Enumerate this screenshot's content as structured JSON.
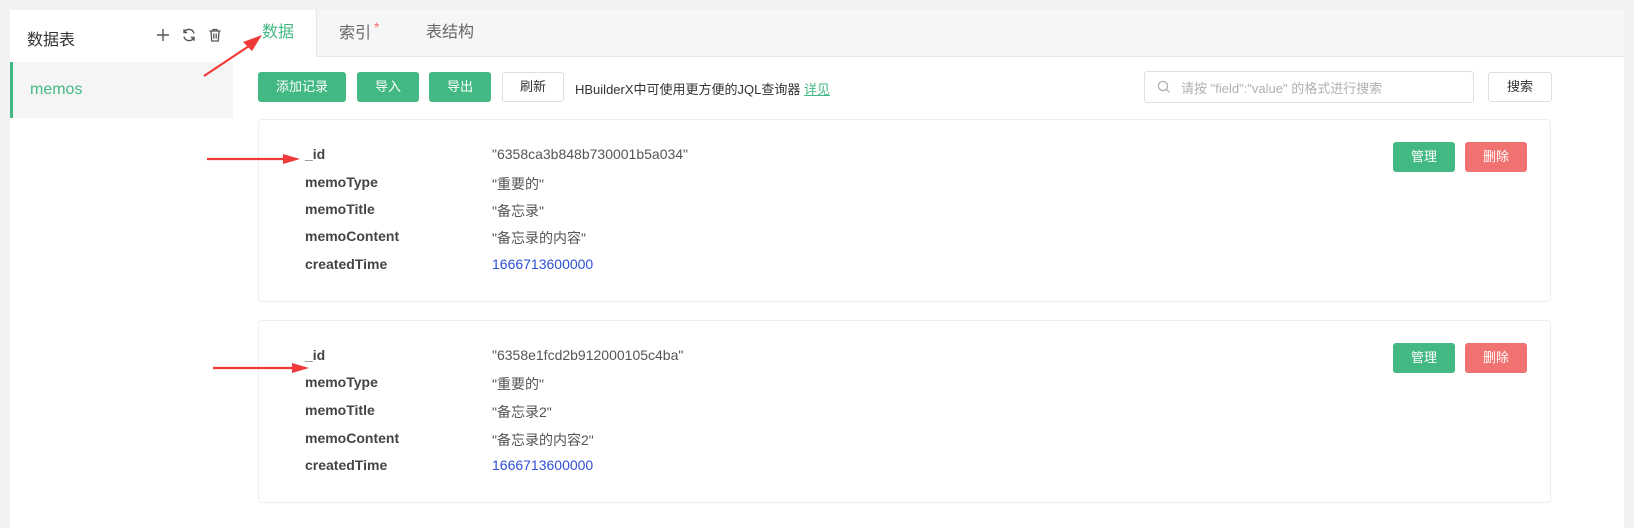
{
  "sidebar": {
    "title": "数据表",
    "icons": [
      "plus-icon",
      "refresh-icon",
      "trash-icon"
    ],
    "tables": [
      {
        "name": "memos",
        "selected": true
      }
    ]
  },
  "tabs": [
    {
      "label": "数据",
      "active": true
    },
    {
      "label": "索引",
      "marker": "*"
    },
    {
      "label": "表结构"
    }
  ],
  "toolbar": {
    "add_label": "添加记录",
    "import_label": "导入",
    "export_label": "导出",
    "refresh_label": "刷新",
    "hint_text": "HBuilderX中可使用更方便的JQL查询器",
    "hint_link": "详见",
    "search_placeholder": "请按 \"field\":\"value\" 的格式进行搜索",
    "search_value": "",
    "search_label": "搜索"
  },
  "records": [
    {
      "fields": [
        {
          "key": "_id",
          "value": "\"6358ca3b848b730001b5a034\"",
          "type": "string"
        },
        {
          "key": "memoType",
          "value": "\"重要的\"",
          "type": "string"
        },
        {
          "key": "memoTitle",
          "value": "\"备忘录\"",
          "type": "string"
        },
        {
          "key": "memoContent",
          "value": "\"备忘录的内容\"",
          "type": "string"
        },
        {
          "key": "createdTime",
          "value": "1666713600000",
          "type": "number"
        }
      ],
      "manage_label": "管理",
      "delete_label": "删除"
    },
    {
      "fields": [
        {
          "key": "_id",
          "value": "\"6358e1fcd2b912000105c4ba\"",
          "type": "string"
        },
        {
          "key": "memoType",
          "value": "\"重要的\"",
          "type": "string"
        },
        {
          "key": "memoTitle",
          "value": "\"备忘录2\"",
          "type": "string"
        },
        {
          "key": "memoContent",
          "value": "\"备忘录的内容2\"",
          "type": "string"
        },
        {
          "key": "createdTime",
          "value": "1666713600000",
          "type": "number"
        }
      ],
      "manage_label": "管理",
      "delete_label": "删除"
    }
  ],
  "colors": {
    "accent": "#42b983",
    "danger": "#f07372",
    "number": "#2f4fd4",
    "annotation_arrow": "#f03a3a"
  }
}
